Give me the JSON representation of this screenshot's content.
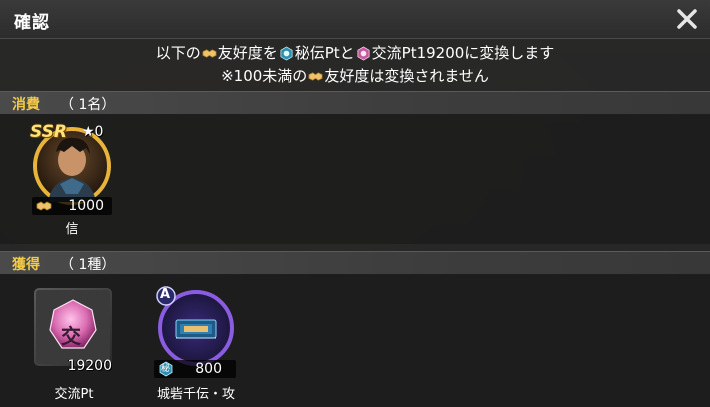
{
  "dialog": {
    "title": "確認",
    "close_label": "×"
  },
  "message": {
    "line1_a": "以下の",
    "line1_b": "友好度を",
    "line1_c": "秘伝Ptと",
    "line1_d": "交流Pt19200に変換します",
    "line2_a": "※100未満の",
    "line2_b": "友好度は変換されません"
  },
  "consume": {
    "label": "消費",
    "count": "（ 1名）",
    "items": [
      {
        "name": "信",
        "rarity": "SSR",
        "stars": "★0",
        "quantity": "1000",
        "icon": "handshake-icon"
      }
    ]
  },
  "obtain": {
    "label": "獲得",
    "count": "（ 1種）",
    "items": [
      {
        "name": "交流Pt",
        "glyph": "交",
        "quantity": "19200",
        "icon": "exchange-gem-icon"
      },
      {
        "name": "城砦千伝・攻",
        "badge": "A",
        "quantity": "800",
        "qty_icon_glyph": "秘",
        "icon": "secret-scroll-icon"
      }
    ]
  },
  "colors": {
    "section_label": "#f3c94a",
    "ssr_ring": "#e8b43a",
    "exchange_gem": "#d96bb0",
    "secret_ring": "#8a5ce0",
    "secret_icon": "#3aa6c9"
  }
}
